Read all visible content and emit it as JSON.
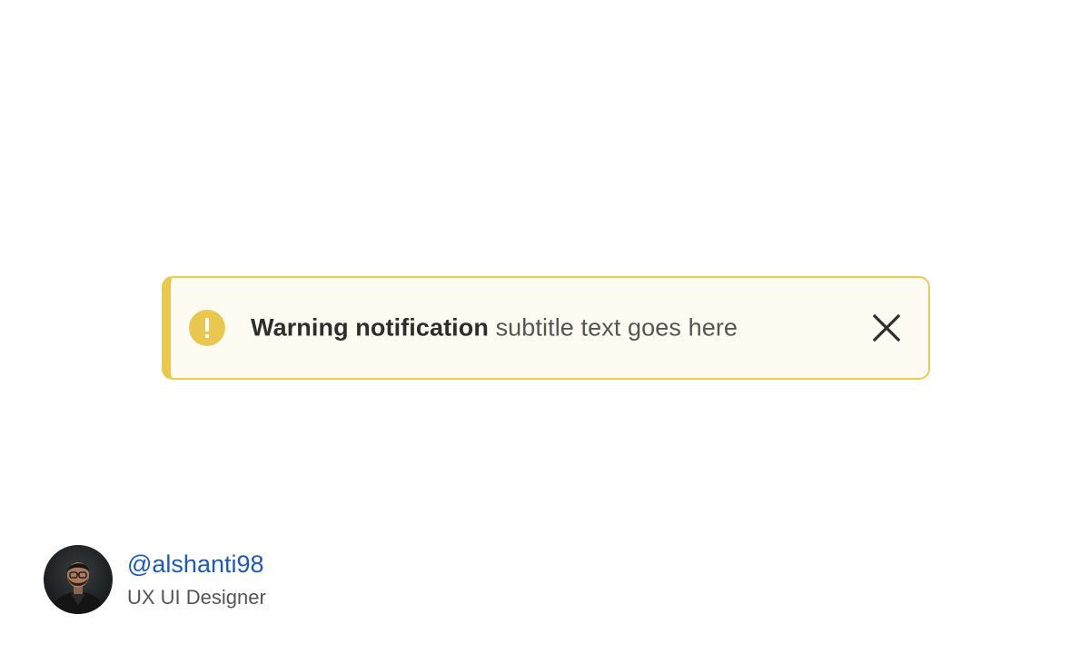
{
  "notification": {
    "title": "Warning notification",
    "subtitle": "subtitle text goes here",
    "icon": "exclamation-icon",
    "close_icon": "close-icon",
    "accent_color": "#e9c750",
    "background_color": "#fefbf3"
  },
  "author": {
    "handle": "@alshanti98",
    "role": "UX UI Designer",
    "handle_color": "#1d5bb5"
  }
}
